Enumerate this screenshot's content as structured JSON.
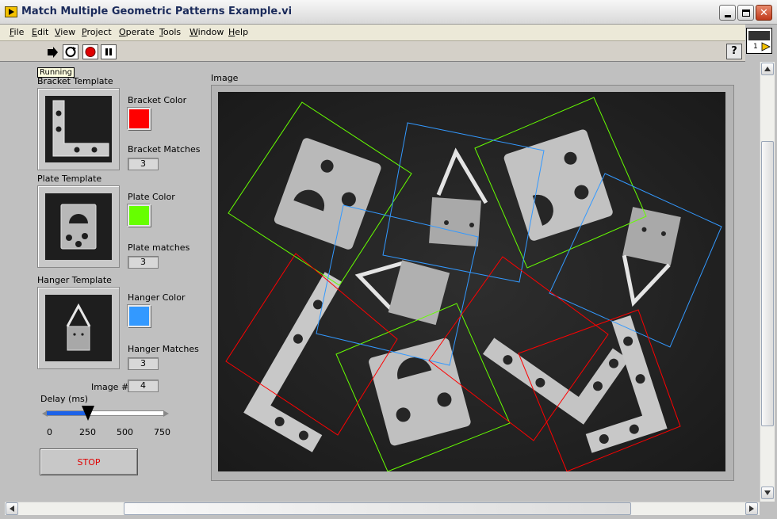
{
  "window": {
    "title": "Match Multiple Geometric Patterns Example.vi"
  },
  "menu": {
    "items": [
      "File",
      "Edit",
      "View",
      "Project",
      "Operate",
      "Tools",
      "Window",
      "Help"
    ]
  },
  "toolbar": {
    "tooltip": "Running",
    "help_label": "?",
    "vi_icon_number": "1"
  },
  "templates": {
    "bracket": {
      "label": "Bracket Template"
    },
    "plate": {
      "label": "Plate Template"
    },
    "hanger": {
      "label": "Hanger Template"
    }
  },
  "colors": {
    "bracket": {
      "label": "Bracket Color",
      "value": "#ff0000"
    },
    "plate": {
      "label": "Plate Color",
      "value": "#66ff00"
    },
    "hanger": {
      "label": "Hanger Color",
      "value": "#3399ff"
    }
  },
  "matches": {
    "bracket": {
      "label": "Bracket Matches",
      "value": "3"
    },
    "plate": {
      "label": "Plate matches",
      "value": "3"
    },
    "hanger": {
      "label": "Hanger Matches",
      "value": "3"
    }
  },
  "image_number": {
    "label": "Image #",
    "value": "4"
  },
  "delay": {
    "label": "Delay (ms)",
    "value": 250,
    "min": 0,
    "max": 750,
    "ticks": [
      "0",
      "250",
      "500",
      "750"
    ]
  },
  "stop_button": {
    "label": "STOP"
  },
  "image": {
    "label": "Image"
  }
}
